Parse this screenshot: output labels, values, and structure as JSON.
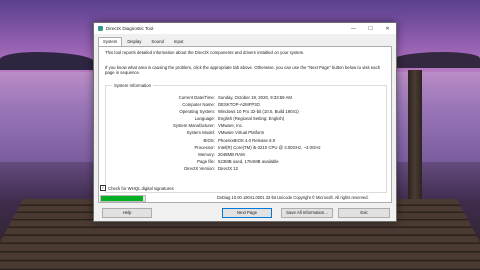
{
  "window": {
    "title": "DirectX Diagnostic Tool",
    "controls": {
      "minimize": "—",
      "maximize": "☐",
      "close": "✕"
    }
  },
  "tabs": [
    "System",
    "Display",
    "Sound",
    "Input"
  ],
  "intro": {
    "line1": "This tool reports detailed information about the DirectX components and drivers installed on your system.",
    "line2": "If you know what area is causing the problem, click the appropriate tab above.  Otherwise, you can use the \"Next Page\" button below to visit each page in sequence."
  },
  "system_info": {
    "title": "System Information",
    "rows": [
      {
        "label": "Current Date/Time:",
        "value": "Sunday, October 18, 2020, 9:33:59 AM"
      },
      {
        "label": "Computer Name:",
        "value": "DESKTOP-A2MFP3O"
      },
      {
        "label": "Operating System:",
        "value": "Windows 10 Pro 32-bit (10.0, Build 19041)"
      },
      {
        "label": "Language:",
        "value": "English (Regional Setting: English)"
      },
      {
        "label": "System Manufacturer:",
        "value": "VMware, Inc."
      },
      {
        "label": "System Model:",
        "value": "VMware Virtual Platform"
      },
      {
        "label": "BIOS:",
        "value": "PhoenixBIOS 4.0 Release 6.0"
      },
      {
        "label": "Processor:",
        "value": "Intel(R) Core(TM) i5-3210 CPU @ 3.00GHz, ~3.0GHz"
      },
      {
        "label": "Memory:",
        "value": "2048MB RAM"
      },
      {
        "label": "Page file:",
        "value": "523MB used, 1764MB available"
      },
      {
        "label": "DirectX Version:",
        "value": "DirectX 12"
      }
    ]
  },
  "whql_checkbox": {
    "label": "Check for WHQL digital signatures",
    "checked": true
  },
  "progress": {
    "fraction": 0.95,
    "color": "#06b025"
  },
  "copyright": "DxDiag 10.00.19041.0001 32-bit Unicode  Copyright © Microsoft. All rights reserved.",
  "buttons": {
    "help": "Help",
    "next_page": "Next Page",
    "save_all": "Save All Information...",
    "exit": "Exit"
  }
}
